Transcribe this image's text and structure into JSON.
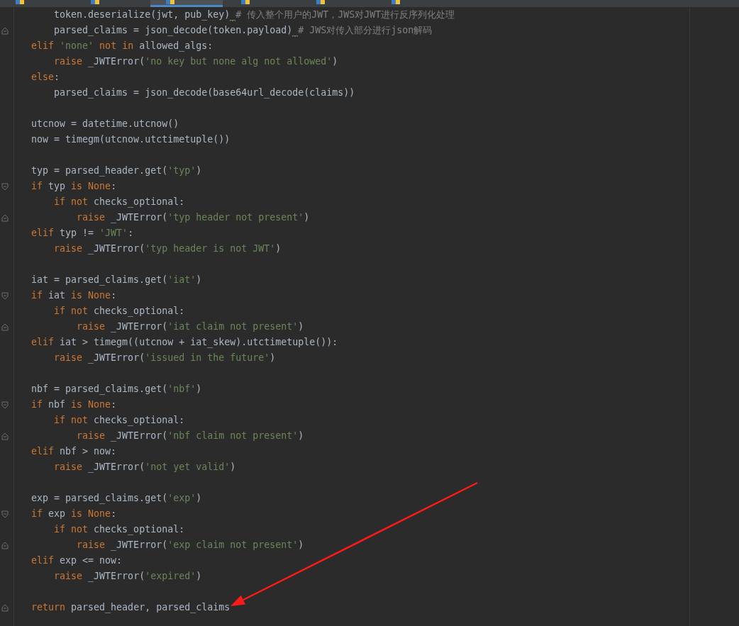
{
  "tabs": [
    {
      "selected": false
    },
    {
      "selected": false
    },
    {
      "selected": true
    },
    {
      "selected": false
    },
    {
      "selected": false
    },
    {
      "selected": false
    }
  ],
  "lines": [
    {
      "kind": "code",
      "segments": [
        {
          "kind": "plain",
          "text": "        token.deserialize(jwt, pub_key)",
          "warning": true
        },
        {
          "kind": "comment",
          "text": "# 传入整个用户的JWT，JWS对JWT进行反序列化处理"
        }
      ]
    },
    {
      "kind": "code",
      "fold_end": true,
      "segments": [
        {
          "kind": "plain",
          "text": "        parsed_claims = json_decode(token.payload)",
          "warning": true
        },
        {
          "kind": "comment",
          "text": "# JWS对传入部分进行json解码"
        }
      ]
    },
    {
      "kind": "code",
      "segments": [
        {
          "kind": "kw",
          "text": "    elif "
        },
        {
          "kind": "str",
          "text": "'none'"
        },
        {
          "kind": "kw",
          "text": " not in"
        },
        {
          "kind": "plain",
          "text": " allowed_algs:"
        }
      ]
    },
    {
      "kind": "code",
      "segments": [
        {
          "kind": "kw",
          "text": "        raise"
        },
        {
          "kind": "plain",
          "text": " _JWTError("
        },
        {
          "kind": "str",
          "text": "'no key but none alg not allowed'"
        },
        {
          "kind": "plain",
          "text": ")"
        }
      ]
    },
    {
      "kind": "code",
      "segments": [
        {
          "kind": "kw",
          "text": "    else"
        },
        {
          "kind": "plain",
          "text": ":"
        }
      ]
    },
    {
      "kind": "code",
      "segments": [
        {
          "kind": "plain",
          "text": "        parsed_claims = json_decode(base64url_decode(claims))"
        }
      ]
    },
    {
      "kind": "blank"
    },
    {
      "kind": "code",
      "segments": [
        {
          "kind": "plain",
          "text": "    utcnow = datetime.utcnow()"
        }
      ]
    },
    {
      "kind": "code",
      "segments": [
        {
          "kind": "plain",
          "text": "    now = timegm(utcnow.utctimetuple())"
        }
      ]
    },
    {
      "kind": "blank"
    },
    {
      "kind": "code",
      "segments": [
        {
          "kind": "plain",
          "text": "    typ = parsed_header.get("
        },
        {
          "kind": "str",
          "text": "'typ'"
        },
        {
          "kind": "plain",
          "text": ")"
        }
      ]
    },
    {
      "kind": "code",
      "fold_start": true,
      "segments": [
        {
          "kind": "kw",
          "text": "    if"
        },
        {
          "kind": "plain",
          "text": " typ "
        },
        {
          "kind": "kw",
          "text": "is None"
        },
        {
          "kind": "plain",
          "text": ":"
        }
      ]
    },
    {
      "kind": "code",
      "segments": [
        {
          "kind": "kw",
          "text": "        if not"
        },
        {
          "kind": "plain",
          "text": " checks_optional:"
        }
      ]
    },
    {
      "kind": "code",
      "fold_end": true,
      "segments": [
        {
          "kind": "kw",
          "text": "            raise"
        },
        {
          "kind": "plain",
          "text": " _JWTError("
        },
        {
          "kind": "str",
          "text": "'typ header not present'"
        },
        {
          "kind": "plain",
          "text": ")"
        }
      ]
    },
    {
      "kind": "code",
      "segments": [
        {
          "kind": "kw",
          "text": "    elif"
        },
        {
          "kind": "plain",
          "text": " typ != "
        },
        {
          "kind": "str",
          "text": "'JWT'"
        },
        {
          "kind": "plain",
          "text": ":"
        }
      ]
    },
    {
      "kind": "code",
      "segments": [
        {
          "kind": "kw",
          "text": "        raise"
        },
        {
          "kind": "plain",
          "text": " _JWTError("
        },
        {
          "kind": "str",
          "text": "'typ header is not JWT'"
        },
        {
          "kind": "plain",
          "text": ")"
        }
      ]
    },
    {
      "kind": "blank"
    },
    {
      "kind": "code",
      "segments": [
        {
          "kind": "plain",
          "text": "    iat = parsed_claims.get("
        },
        {
          "kind": "str",
          "text": "'iat'"
        },
        {
          "kind": "plain",
          "text": ")"
        }
      ]
    },
    {
      "kind": "code",
      "fold_start": true,
      "segments": [
        {
          "kind": "kw",
          "text": "    if"
        },
        {
          "kind": "plain",
          "text": " iat "
        },
        {
          "kind": "kw",
          "text": "is None"
        },
        {
          "kind": "plain",
          "text": ":"
        }
      ]
    },
    {
      "kind": "code",
      "segments": [
        {
          "kind": "kw",
          "text": "        if not"
        },
        {
          "kind": "plain",
          "text": " checks_optional:"
        }
      ]
    },
    {
      "kind": "code",
      "fold_end": true,
      "segments": [
        {
          "kind": "kw",
          "text": "            raise"
        },
        {
          "kind": "plain",
          "text": " _JWTError("
        },
        {
          "kind": "str",
          "text": "'iat claim not present'"
        },
        {
          "kind": "plain",
          "text": ")"
        }
      ]
    },
    {
      "kind": "code",
      "segments": [
        {
          "kind": "kw",
          "text": "    elif"
        },
        {
          "kind": "plain",
          "text": " iat > timegm((utcnow + iat_skew).utctimetuple()):"
        }
      ]
    },
    {
      "kind": "code",
      "segments": [
        {
          "kind": "kw",
          "text": "        raise"
        },
        {
          "kind": "plain",
          "text": " _JWTError("
        },
        {
          "kind": "str",
          "text": "'issued in the future'"
        },
        {
          "kind": "plain",
          "text": ")"
        }
      ]
    },
    {
      "kind": "blank"
    },
    {
      "kind": "code",
      "segments": [
        {
          "kind": "plain",
          "text": "    nbf = parsed_claims.get("
        },
        {
          "kind": "str",
          "text": "'nbf'"
        },
        {
          "kind": "plain",
          "text": ")"
        }
      ]
    },
    {
      "kind": "code",
      "fold_start": true,
      "segments": [
        {
          "kind": "kw",
          "text": "    if"
        },
        {
          "kind": "plain",
          "text": " nbf "
        },
        {
          "kind": "kw",
          "text": "is None"
        },
        {
          "kind": "plain",
          "text": ":"
        }
      ]
    },
    {
      "kind": "code",
      "segments": [
        {
          "kind": "kw",
          "text": "        if not"
        },
        {
          "kind": "plain",
          "text": " checks_optional:"
        }
      ]
    },
    {
      "kind": "code",
      "fold_end": true,
      "segments": [
        {
          "kind": "kw",
          "text": "            raise"
        },
        {
          "kind": "plain",
          "text": " _JWTError("
        },
        {
          "kind": "str",
          "text": "'nbf claim not present'"
        },
        {
          "kind": "plain",
          "text": ")"
        }
      ]
    },
    {
      "kind": "code",
      "segments": [
        {
          "kind": "kw",
          "text": "    elif"
        },
        {
          "kind": "plain",
          "text": " nbf > now:"
        }
      ]
    },
    {
      "kind": "code",
      "segments": [
        {
          "kind": "kw",
          "text": "        raise"
        },
        {
          "kind": "plain",
          "text": " _JWTError("
        },
        {
          "kind": "str",
          "text": "'not yet valid'"
        },
        {
          "kind": "plain",
          "text": ")"
        }
      ]
    },
    {
      "kind": "blank"
    },
    {
      "kind": "code",
      "segments": [
        {
          "kind": "plain",
          "text": "    exp = parsed_claims.get("
        },
        {
          "kind": "str",
          "text": "'exp'"
        },
        {
          "kind": "plain",
          "text": ")"
        }
      ]
    },
    {
      "kind": "code",
      "fold_start": true,
      "segments": [
        {
          "kind": "kw",
          "text": "    if"
        },
        {
          "kind": "plain",
          "text": " exp "
        },
        {
          "kind": "kw",
          "text": "is None"
        },
        {
          "kind": "plain",
          "text": ":"
        }
      ]
    },
    {
      "kind": "code",
      "segments": [
        {
          "kind": "kw",
          "text": "        if not"
        },
        {
          "kind": "plain",
          "text": " checks_optional:"
        }
      ]
    },
    {
      "kind": "code",
      "fold_end": true,
      "segments": [
        {
          "kind": "kw",
          "text": "            raise"
        },
        {
          "kind": "plain",
          "text": " _JWTError("
        },
        {
          "kind": "str",
          "text": "'exp claim not present'"
        },
        {
          "kind": "plain",
          "text": ")"
        }
      ]
    },
    {
      "kind": "code",
      "segments": [
        {
          "kind": "kw",
          "text": "    elif"
        },
        {
          "kind": "plain",
          "text": " exp <= now:"
        }
      ]
    },
    {
      "kind": "code",
      "segments": [
        {
          "kind": "kw",
          "text": "        raise"
        },
        {
          "kind": "plain",
          "text": " _JWTError("
        },
        {
          "kind": "str",
          "text": "'expired'"
        },
        {
          "kind": "plain",
          "text": ")"
        }
      ]
    },
    {
      "kind": "blank"
    },
    {
      "kind": "code",
      "fold_end": true,
      "segments": [
        {
          "kind": "kw",
          "text": "    return"
        },
        {
          "kind": "plain",
          "text": " parsed_header, parsed_claims"
        }
      ]
    }
  ],
  "annotation": {
    "kind": "arrow"
  }
}
